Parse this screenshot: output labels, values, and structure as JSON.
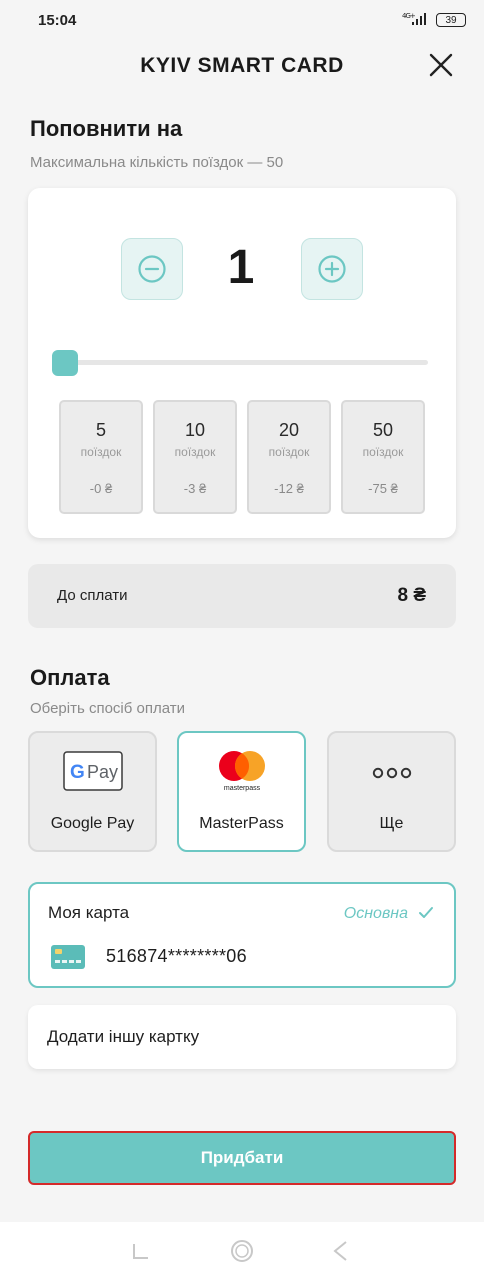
{
  "status_bar": {
    "time": "15:04",
    "network": "4G+",
    "battery": "39"
  },
  "header": {
    "title": "KYIV SMART CARD",
    "close_icon": "close-icon"
  },
  "topup": {
    "title": "Поповнити на",
    "subtitle": "Максимальна кількість поїздок — 50",
    "stepper_value": "1",
    "slider_value": 1,
    "slider_max": 50,
    "presets": [
      {
        "count": "5",
        "unit": "поїздок",
        "discount": "-0 ₴"
      },
      {
        "count": "10",
        "unit": "поїздок",
        "discount": "-3 ₴"
      },
      {
        "count": "20",
        "unit": "поїздок",
        "discount": "-12 ₴"
      },
      {
        "count": "50",
        "unit": "поїздок",
        "discount": "-75 ₴"
      }
    ]
  },
  "total": {
    "label": "До сплати",
    "value": "8 ₴"
  },
  "payment": {
    "title": "Оплата",
    "subtitle": "Оберіть спосіб оплати",
    "methods": [
      {
        "label": "Google Pay",
        "icon": "google-pay-icon",
        "selected": false
      },
      {
        "label": "MasterPass",
        "icon": "masterpass-icon",
        "brand_text": "masterpass",
        "selected": true
      },
      {
        "label": "Ще",
        "icon": "more-dots-icon",
        "selected": false
      }
    ]
  },
  "my_card": {
    "title": "Моя карта",
    "badge": "Основна",
    "number": "516874********06"
  },
  "add_card": {
    "label": "Додати іншу картку"
  },
  "buy_button": {
    "label": "Придбати"
  },
  "colors": {
    "accent": "#6cc7c3",
    "accent_light": "#e6f4f3",
    "buy_button_outline": "#d42a2a",
    "mastercard_red": "#eb001b",
    "mastercard_orange": "#f79e1b"
  }
}
